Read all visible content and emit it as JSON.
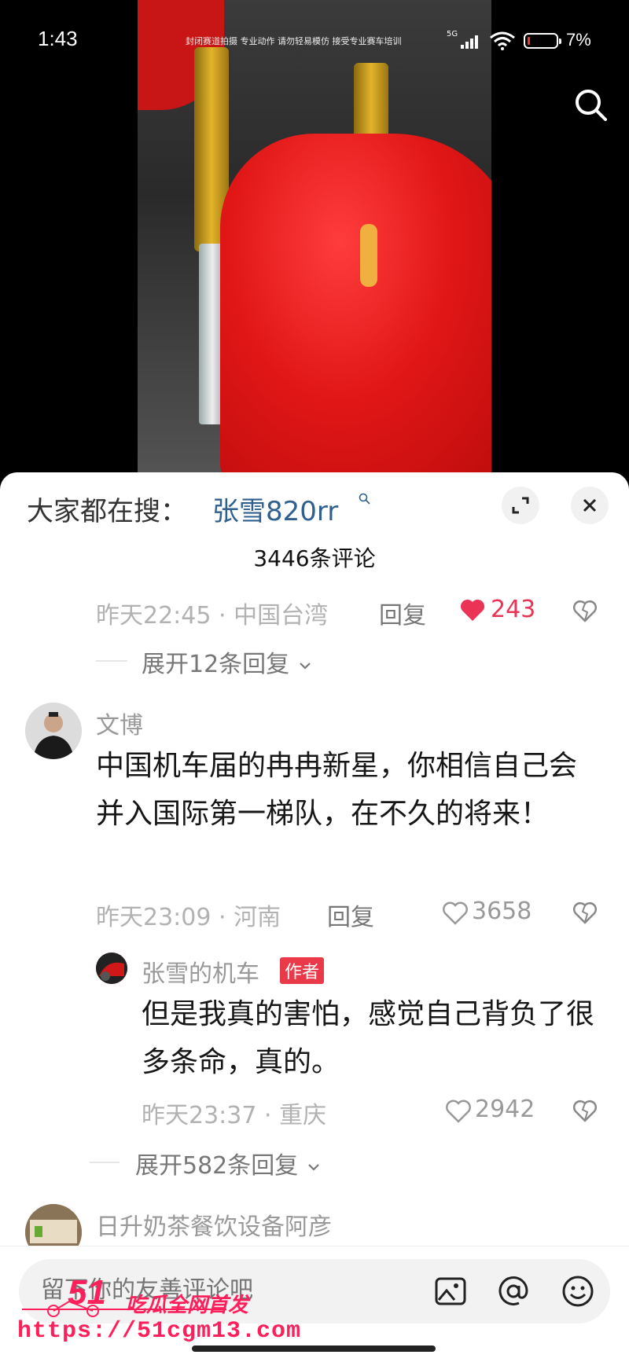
{
  "status_bar": {
    "time": "1:43",
    "ticker": "封闭赛道拍摄 专业动作 请勿轻易模仿 接受专业赛车培训",
    "network": "5G",
    "battery": "7%"
  },
  "video": {
    "search_icon": "search-icon"
  },
  "sheet": {
    "trending_label": "大家都在搜：",
    "trending_term": "张雪820rr",
    "comment_count": "3446条评论"
  },
  "comments": {
    "c0": {
      "meta": "昨天22:45 · 中国台湾",
      "reply": "回复",
      "likes": "243",
      "expand": "展开12条回复"
    },
    "c1": {
      "username": "文博",
      "text": "中国机车届的冉冉新星，你相信自己会并入国际第一梯队，在不久的将来！",
      "meta": "昨天23:09 · 河南",
      "reply": "回复",
      "likes": "3658",
      "sub": {
        "username": "张雪的机车",
        "badge": "作者",
        "text": "但是我真的害怕，感觉自己背负了很多条命，真的。",
        "meta": "昨天23:37 · 重庆",
        "likes": "2942"
      },
      "expand": "展开582条回复"
    },
    "c2": {
      "username": "日升奶茶餐饮设备阿彦"
    }
  },
  "input": {
    "placeholder": "留下你的友善评论吧"
  },
  "watermark": {
    "logo": "51",
    "title": "吃瓜全网首发",
    "url": "https://51cgm13.com"
  },
  "colors": {
    "liked": "#ea3355",
    "trending": "#2f5f8f",
    "badge": "#ea3a4a"
  }
}
